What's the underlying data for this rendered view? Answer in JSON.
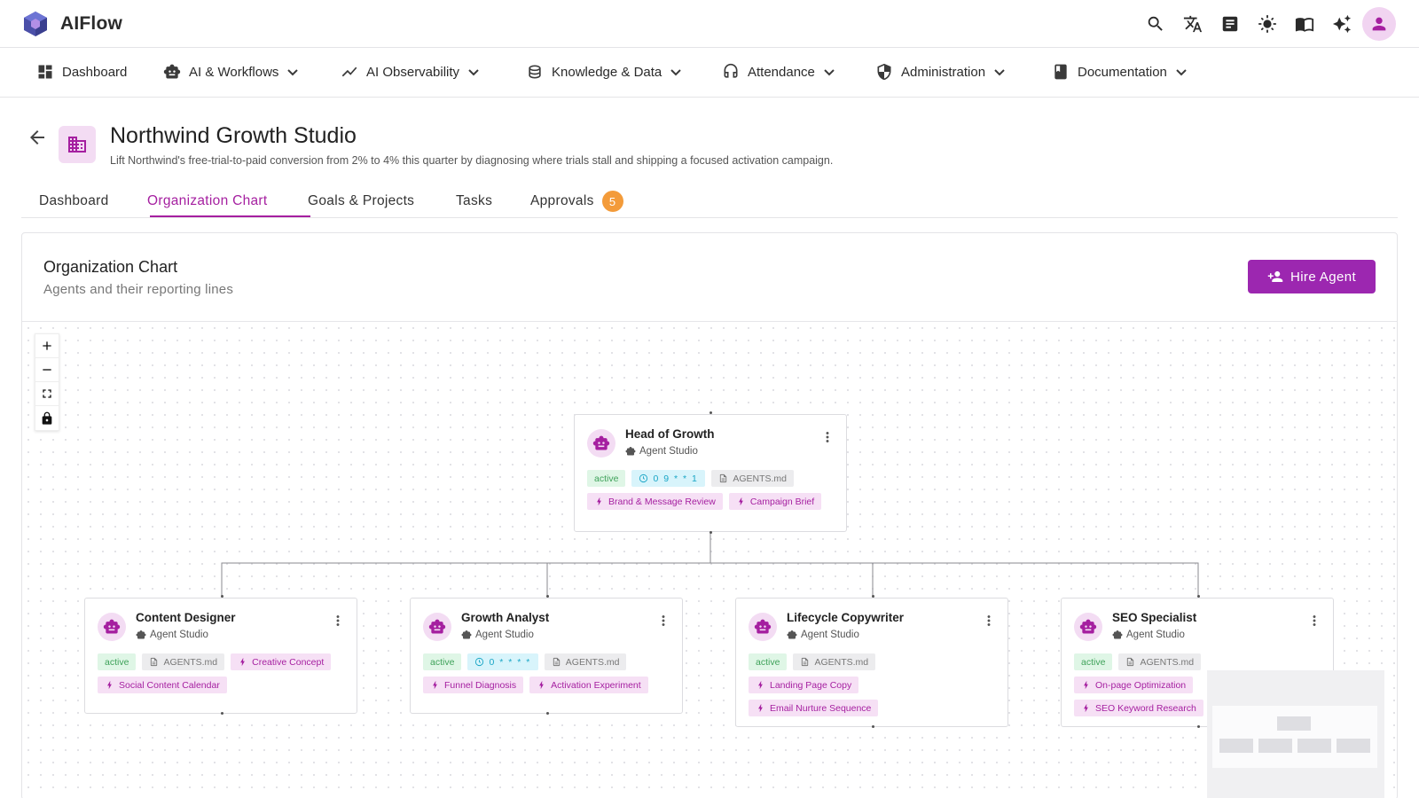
{
  "app": {
    "name": "AIFlow"
  },
  "topbar": {
    "icons": [
      "search-icon",
      "translate-icon",
      "calculator-icon",
      "brightness-icon",
      "map-book-icon",
      "sparkles-icon",
      "account-icon"
    ]
  },
  "nav": {
    "items": [
      {
        "label": "Dashboard",
        "icon": "dashboard-icon",
        "dropdown": false
      },
      {
        "label": "AI & Workflows",
        "icon": "robot-icon",
        "dropdown": true
      },
      {
        "label": "AI Observability",
        "icon": "trend-icon",
        "dropdown": true
      },
      {
        "label": "Knowledge & Data",
        "icon": "database-icon",
        "dropdown": true
      },
      {
        "label": "Attendance",
        "icon": "headset-icon",
        "dropdown": true
      },
      {
        "label": "Administration",
        "icon": "shield-icon",
        "dropdown": true
      },
      {
        "label": "Documentation",
        "icon": "book-icon",
        "dropdown": true
      }
    ]
  },
  "page": {
    "title": "Northwind Growth Studio",
    "subtitle": "Lift Northwind's free-trial-to-paid conversion from 2% to 4% this quarter by diagnosing where trials stall and shipping a focused activation campaign."
  },
  "tabs": [
    {
      "label": "Dashboard",
      "active": false
    },
    {
      "label": "Organization Chart",
      "active": true
    },
    {
      "label": "Goals & Projects",
      "active": false
    },
    {
      "label": "Tasks",
      "active": false
    },
    {
      "label": "Approvals",
      "active": false,
      "badge": "5"
    }
  ],
  "org_card": {
    "title": "Organization Chart",
    "subtitle": "Agents and their reporting lines",
    "hire_label": "Hire Agent"
  },
  "zoom_controls": [
    "zoom-in-icon",
    "zoom-out-icon",
    "fit-view-icon",
    "lock-icon"
  ],
  "agents": {
    "head": {
      "name": "Head of Growth",
      "studio": "Agent Studio",
      "status": "active",
      "schedule": "0 9 * * 1",
      "file": "AGENTS.md",
      "skills": [
        "Brand & Message Review",
        "Campaign Brief"
      ]
    },
    "content_designer": {
      "name": "Content Designer",
      "studio": "Agent Studio",
      "status": "active",
      "file": "AGENTS.md",
      "skills": [
        "Creative Concept",
        "Social Content Calendar"
      ]
    },
    "growth_analyst": {
      "name": "Growth Analyst",
      "studio": "Agent Studio",
      "status": "active",
      "schedule": "0 * * * *",
      "file": "AGENTS.md",
      "skills": [
        "Funnel Diagnosis",
        "Activation Experiment"
      ]
    },
    "lifecycle_copywriter": {
      "name": "Lifecycle Copywriter",
      "studio": "Agent Studio",
      "status": "active",
      "file": "AGENTS.md",
      "skills": [
        "Landing Page Copy",
        "Email Nurture Sequence"
      ]
    },
    "seo_specialist": {
      "name": "SEO Specialist",
      "studio": "Agent Studio",
      "status": "active",
      "file": "AGENTS.md",
      "skills": [
        "On-page Optimization",
        "SEO Keyword Research"
      ]
    }
  },
  "colors": {
    "accent": "#9c27b0",
    "accent_text": "#a51fa0",
    "badge": "#f39b3a",
    "status_green": "#3fa25a",
    "cron_cyan": "#1aa6c6"
  }
}
